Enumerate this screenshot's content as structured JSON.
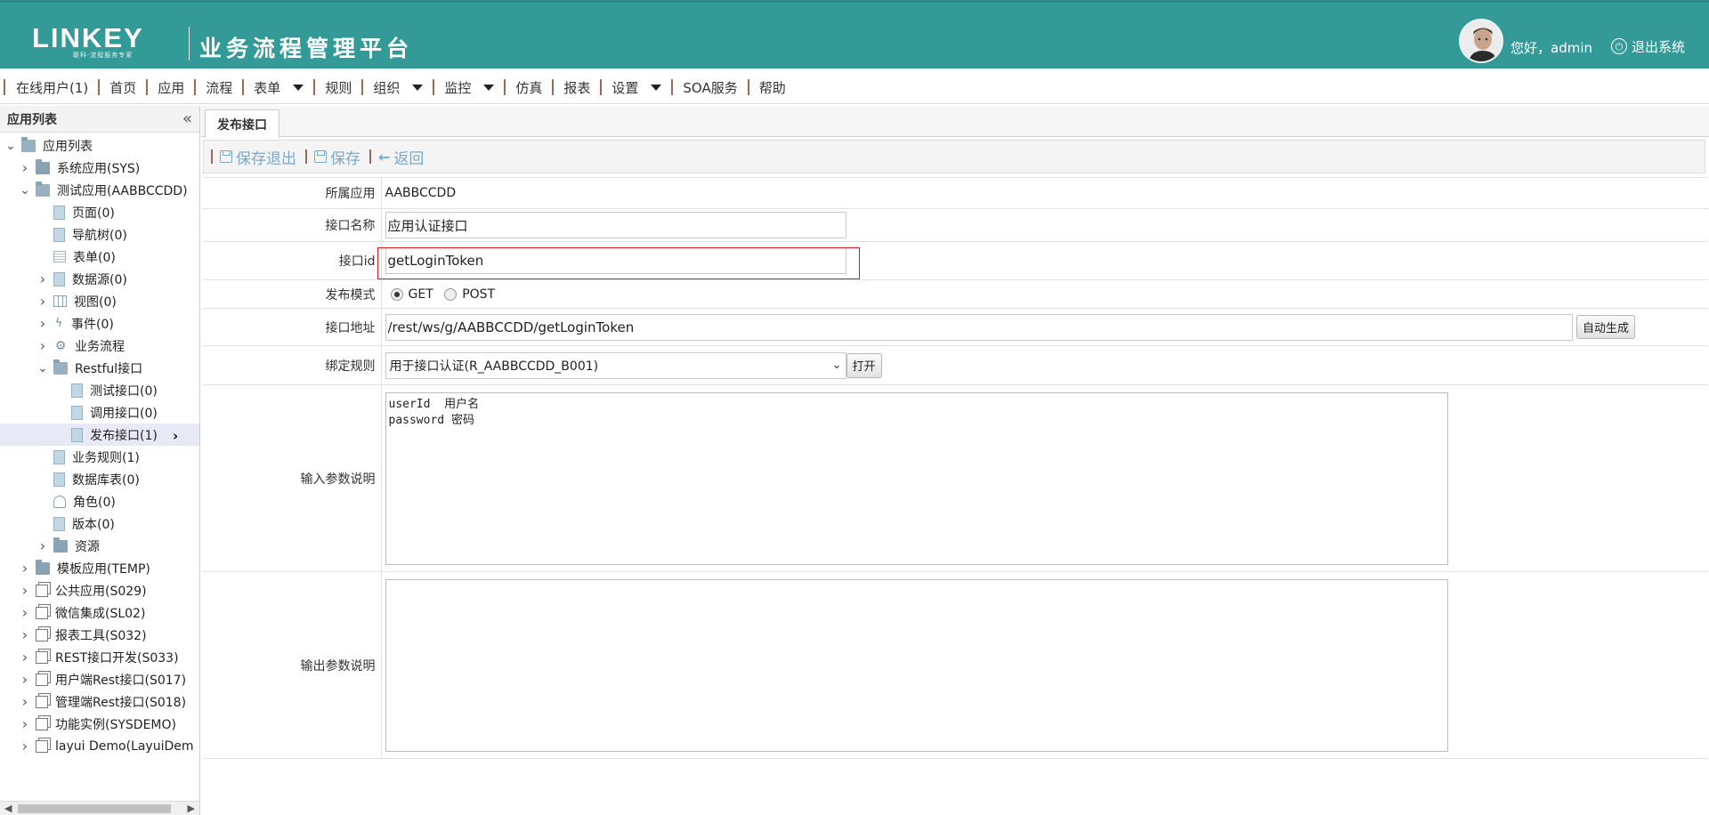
{
  "header": {
    "logo_text": "LINKEY",
    "logo_sub": "联科·流程服务专家",
    "title": "业务流程管理平台",
    "greeting": "您好，admin",
    "logout_label": "退出系统"
  },
  "menu": [
    {
      "label": "在线用户(1)",
      "dropdown": false
    },
    {
      "label": "首页",
      "dropdown": false
    },
    {
      "label": "应用",
      "dropdown": false
    },
    {
      "label": "流程",
      "dropdown": false
    },
    {
      "label": "表单",
      "dropdown": true
    },
    {
      "label": "规则",
      "dropdown": false
    },
    {
      "label": "组织",
      "dropdown": true
    },
    {
      "label": "监控",
      "dropdown": true
    },
    {
      "label": "仿真",
      "dropdown": false
    },
    {
      "label": "报表",
      "dropdown": false
    },
    {
      "label": "设置",
      "dropdown": true
    },
    {
      "label": "SOA服务",
      "dropdown": false
    },
    {
      "label": "帮助",
      "dropdown": false
    }
  ],
  "left_panel": {
    "title": "应用列表",
    "tree": [
      {
        "label": "应用列表",
        "level": 0,
        "icon": "folder-open-icon",
        "toggle": "down"
      },
      {
        "label": "系统应用(SYS)",
        "level": 1,
        "icon": "folder-icon",
        "toggle": "right"
      },
      {
        "label": "测试应用(AABBCCDD)",
        "level": 1,
        "icon": "folder-open-icon",
        "toggle": "down"
      },
      {
        "label": "页面(0)",
        "level": 2,
        "icon": "file-icon",
        "toggle": ""
      },
      {
        "label": "导航树(0)",
        "level": 2,
        "icon": "file-icon",
        "toggle": ""
      },
      {
        "label": "表单(0)",
        "level": 2,
        "icon": "form-icon",
        "toggle": ""
      },
      {
        "label": "数据源(0)",
        "level": 2,
        "icon": "file-icon",
        "toggle": "right"
      },
      {
        "label": "视图(0)",
        "level": 2,
        "icon": "grid-icon",
        "toggle": "right"
      },
      {
        "label": "事件(0)",
        "level": 2,
        "icon": "bolt-icon",
        "toggle": "right"
      },
      {
        "label": "业务流程",
        "level": 2,
        "icon": "gears-icon",
        "toggle": "right"
      },
      {
        "label": "Restful接口",
        "level": 2,
        "icon": "folder-open-icon",
        "toggle": "down"
      },
      {
        "label": "测试接口(0)",
        "level": 3,
        "icon": "file-icon",
        "toggle": ""
      },
      {
        "label": "调用接口(0)",
        "level": 3,
        "icon": "file-icon",
        "toggle": ""
      },
      {
        "label": "发布接口(1)",
        "level": 3,
        "icon": "file-icon",
        "toggle": "",
        "selected": true
      },
      {
        "label": "业务规则(1)",
        "level": 2,
        "icon": "file-icon",
        "toggle": ""
      },
      {
        "label": "数据库表(0)",
        "level": 2,
        "icon": "file-icon",
        "toggle": ""
      },
      {
        "label": "角色(0)",
        "level": 2,
        "icon": "user-icon",
        "toggle": ""
      },
      {
        "label": "版本(0)",
        "level": 2,
        "icon": "file-icon",
        "toggle": ""
      },
      {
        "label": "资源",
        "level": 2,
        "icon": "folder-icon",
        "toggle": "right"
      },
      {
        "label": "模板应用(TEMP)",
        "level": 1,
        "icon": "folder-icon",
        "toggle": "right"
      },
      {
        "label": "公共应用(S029)",
        "level": 1,
        "icon": "app-icon",
        "toggle": "right"
      },
      {
        "label": "微信集成(SL02)",
        "level": 1,
        "icon": "app-icon",
        "toggle": "right"
      },
      {
        "label": "报表工具(S032)",
        "level": 1,
        "icon": "app-icon",
        "toggle": "right"
      },
      {
        "label": "REST接口开发(S033)",
        "level": 1,
        "icon": "app-icon",
        "toggle": "right"
      },
      {
        "label": "用户端Rest接口(S017)",
        "level": 1,
        "icon": "app-icon",
        "toggle": "right"
      },
      {
        "label": "管理端Rest接口(S018)",
        "level": 1,
        "icon": "app-icon",
        "toggle": "right"
      },
      {
        "label": "功能实例(SYSDEMO)",
        "level": 1,
        "icon": "app-icon",
        "toggle": "right"
      },
      {
        "label": "layui Demo(LayuiDem",
        "level": 1,
        "icon": "app-icon",
        "toggle": "right"
      }
    ]
  },
  "tab": {
    "label": "发布接口"
  },
  "toolbar": {
    "save_exit_label": "保存退出",
    "save_label": "保存",
    "back_label": "返回"
  },
  "form": {
    "app_label": "所属应用",
    "app_value": "AABBCCDD",
    "name_label": "接口名称",
    "name_value": "应用认证接口",
    "id_label": "接口id",
    "id_value": "getLoginToken",
    "mode_label": "发布模式",
    "mode_options": [
      "GET",
      "POST"
    ],
    "mode_selected": "GET",
    "url_label": "接口地址",
    "url_value": "/rest/ws/g/AABBCCDD/getLoginToken",
    "auto_gen_label": "自动生成",
    "rule_label": "绑定规则",
    "rule_value": "用于接口认证(R_AABBCCDD_B001)",
    "open_label": "打开",
    "input_label": "输入参数说明",
    "input_value": "userId  用户名\npassword 密码",
    "output_label": "输出参数说明",
    "output_value": ""
  },
  "colors": {
    "header_bg": "#349a98",
    "highlight": "#e0191e",
    "toolbar_btn": "#7aa9c9"
  }
}
